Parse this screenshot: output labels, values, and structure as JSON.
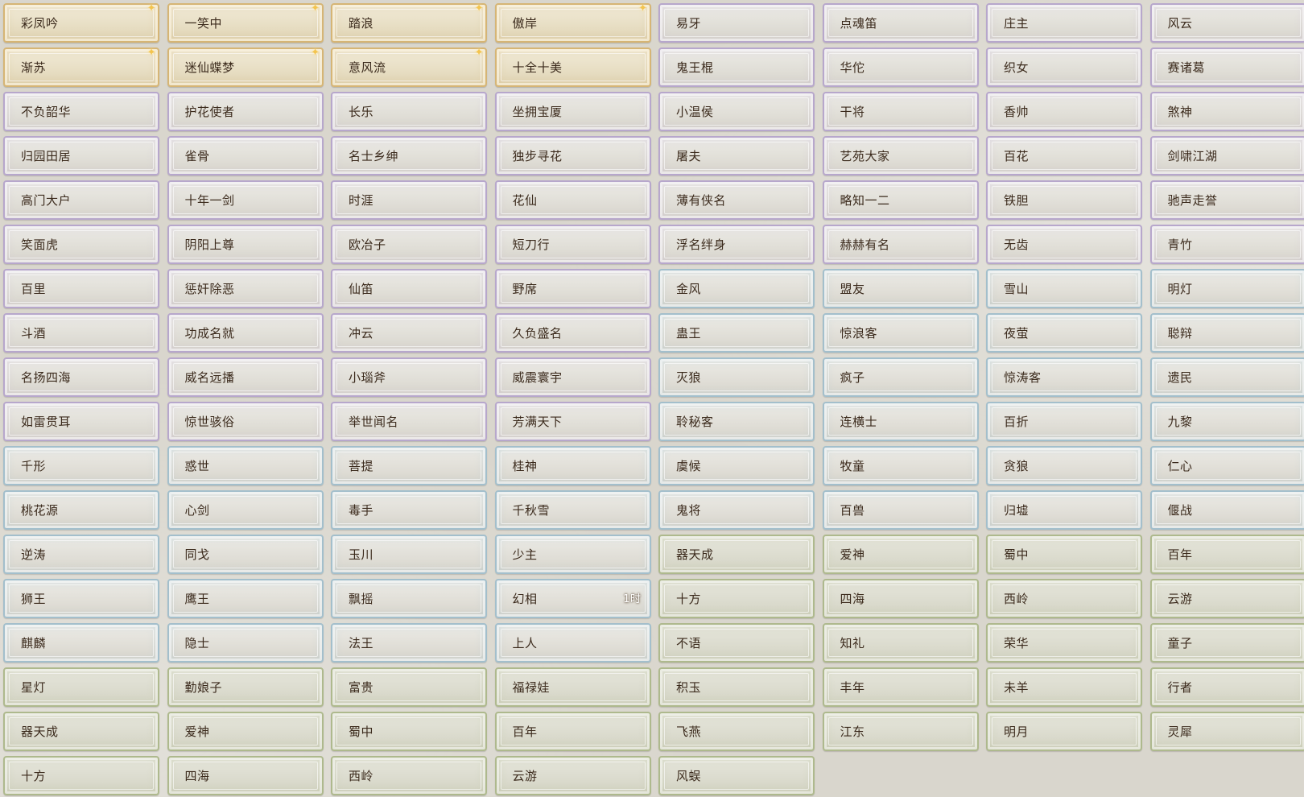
{
  "titles": [
    {
      "label": "彩凤吟",
      "tier": "gold",
      "sparkle": true
    },
    {
      "label": "一笑中",
      "tier": "gold",
      "sparkle": true
    },
    {
      "label": "踏浪",
      "tier": "gold",
      "sparkle": true
    },
    {
      "label": "傲岸",
      "tier": "gold",
      "sparkle": true
    },
    {
      "label": "易牙",
      "tier": "purple"
    },
    {
      "label": "点魂笛",
      "tier": "purple"
    },
    {
      "label": "庄主",
      "tier": "purple"
    },
    {
      "label": "风云",
      "tier": "purple"
    },
    {
      "label": "渐苏",
      "tier": "gold",
      "sparkle": true
    },
    {
      "label": "迷仙蝶梦",
      "tier": "gold",
      "sparkle": true
    },
    {
      "label": "意风流",
      "tier": "gold",
      "sparkle": true
    },
    {
      "label": "十全十美",
      "tier": "gold"
    },
    {
      "label": "鬼王棍",
      "tier": "purple"
    },
    {
      "label": "华佗",
      "tier": "purple"
    },
    {
      "label": "织女",
      "tier": "purple"
    },
    {
      "label": "赛诸葛",
      "tier": "purple"
    },
    {
      "label": "不负韶华",
      "tier": "purple"
    },
    {
      "label": "护花使者",
      "tier": "purple"
    },
    {
      "label": "长乐",
      "tier": "purple"
    },
    {
      "label": "坐拥宝厦",
      "tier": "purple"
    },
    {
      "label": "小温侯",
      "tier": "purple"
    },
    {
      "label": "干将",
      "tier": "purple"
    },
    {
      "label": "香帅",
      "tier": "purple"
    },
    {
      "label": "煞神",
      "tier": "purple"
    },
    {
      "label": "归园田居",
      "tier": "purple"
    },
    {
      "label": "雀骨",
      "tier": "purple"
    },
    {
      "label": "名士乡绅",
      "tier": "purple"
    },
    {
      "label": "独步寻花",
      "tier": "purple"
    },
    {
      "label": "屠夫",
      "tier": "purple"
    },
    {
      "label": "艺苑大家",
      "tier": "purple"
    },
    {
      "label": "百花",
      "tier": "purple"
    },
    {
      "label": "剑啸江湖",
      "tier": "purple"
    },
    {
      "label": "高门大户",
      "tier": "purple"
    },
    {
      "label": "十年一剑",
      "tier": "purple"
    },
    {
      "label": "时涯",
      "tier": "purple"
    },
    {
      "label": "花仙",
      "tier": "purple"
    },
    {
      "label": "薄有侠名",
      "tier": "purple"
    },
    {
      "label": "略知一二",
      "tier": "purple"
    },
    {
      "label": "铁胆",
      "tier": "purple"
    },
    {
      "label": "驰声走誉",
      "tier": "purple"
    },
    {
      "label": "笑面虎",
      "tier": "purple"
    },
    {
      "label": "阴阳上尊",
      "tier": "purple"
    },
    {
      "label": "欧冶子",
      "tier": "purple"
    },
    {
      "label": "短刀行",
      "tier": "purple"
    },
    {
      "label": "浮名绊身",
      "tier": "purple"
    },
    {
      "label": "赫赫有名",
      "tier": "purple"
    },
    {
      "label": "无齿",
      "tier": "purple"
    },
    {
      "label": "青竹",
      "tier": "purple"
    },
    {
      "label": "百里",
      "tier": "purple"
    },
    {
      "label": "惩奸除恶",
      "tier": "purple"
    },
    {
      "label": "仙笛",
      "tier": "purple"
    },
    {
      "label": "野席",
      "tier": "purple"
    },
    {
      "label": "金风",
      "tier": "blue"
    },
    {
      "label": "盟友",
      "tier": "blue"
    },
    {
      "label": "雪山",
      "tier": "blue"
    },
    {
      "label": "明灯",
      "tier": "blue"
    },
    {
      "label": "斗酒",
      "tier": "purple"
    },
    {
      "label": "功成名就",
      "tier": "purple"
    },
    {
      "label": "冲云",
      "tier": "purple"
    },
    {
      "label": "久负盛名",
      "tier": "purple"
    },
    {
      "label": "蛊王",
      "tier": "blue"
    },
    {
      "label": "惊浪客",
      "tier": "blue"
    },
    {
      "label": "夜萤",
      "tier": "blue"
    },
    {
      "label": "聪辩",
      "tier": "blue"
    },
    {
      "label": "名扬四海",
      "tier": "purple"
    },
    {
      "label": "威名远播",
      "tier": "purple"
    },
    {
      "label": "小瑙斧",
      "tier": "purple"
    },
    {
      "label": "威震寰宇",
      "tier": "purple"
    },
    {
      "label": "灭狼",
      "tier": "blue"
    },
    {
      "label": "疯子",
      "tier": "blue"
    },
    {
      "label": "惊涛客",
      "tier": "blue"
    },
    {
      "label": "遗民",
      "tier": "blue"
    },
    {
      "label": "如雷贯耳",
      "tier": "purple"
    },
    {
      "label": "惊世骇俗",
      "tier": "purple"
    },
    {
      "label": "举世闻名",
      "tier": "purple"
    },
    {
      "label": "芳满天下",
      "tier": "purple"
    },
    {
      "label": "聆秘客",
      "tier": "blue"
    },
    {
      "label": "连横士",
      "tier": "blue"
    },
    {
      "label": "百折",
      "tier": "blue"
    },
    {
      "label": "九黎",
      "tier": "blue"
    },
    {
      "label": "千形",
      "tier": "blue"
    },
    {
      "label": "惑世",
      "tier": "blue"
    },
    {
      "label": "菩提",
      "tier": "blue"
    },
    {
      "label": "桂神",
      "tier": "blue"
    },
    {
      "label": "虞候",
      "tier": "blue"
    },
    {
      "label": "牧童",
      "tier": "blue"
    },
    {
      "label": "贪狼",
      "tier": "blue"
    },
    {
      "label": "仁心",
      "tier": "blue"
    },
    {
      "label": "桃花源",
      "tier": "blue"
    },
    {
      "label": "心剑",
      "tier": "blue"
    },
    {
      "label": "毒手",
      "tier": "blue"
    },
    {
      "label": "千秋雪",
      "tier": "blue"
    },
    {
      "label": "鬼将",
      "tier": "blue"
    },
    {
      "label": "百兽",
      "tier": "blue"
    },
    {
      "label": "归墟",
      "tier": "blue"
    },
    {
      "label": "偃战",
      "tier": "blue"
    },
    {
      "label": "逆涛",
      "tier": "blue"
    },
    {
      "label": "同戈",
      "tier": "blue"
    },
    {
      "label": "玉川",
      "tier": "blue"
    },
    {
      "label": "少主",
      "tier": "blue"
    },
    {
      "label": "器天成",
      "tier": "green"
    },
    {
      "label": "爱神",
      "tier": "green"
    },
    {
      "label": "蜀中",
      "tier": "green"
    },
    {
      "label": "百年",
      "tier": "green"
    },
    {
      "label": "狮王",
      "tier": "blue"
    },
    {
      "label": "鹰王",
      "tier": "blue"
    },
    {
      "label": "飘摇",
      "tier": "blue"
    },
    {
      "label": "幻相",
      "tier": "blue",
      "badge": "1时"
    },
    {
      "label": "十方",
      "tier": "green"
    },
    {
      "label": "四海",
      "tier": "green"
    },
    {
      "label": "西岭",
      "tier": "green"
    },
    {
      "label": "云游",
      "tier": "green"
    },
    {
      "label": "麒麟",
      "tier": "blue"
    },
    {
      "label": "隐士",
      "tier": "blue"
    },
    {
      "label": "法王",
      "tier": "blue"
    },
    {
      "label": "上人",
      "tier": "blue"
    },
    {
      "label": "不语",
      "tier": "green"
    },
    {
      "label": "知礼",
      "tier": "green"
    },
    {
      "label": "荣华",
      "tier": "green"
    },
    {
      "label": "童子",
      "tier": "green"
    },
    {
      "label": "星灯",
      "tier": "green"
    },
    {
      "label": "勤娘子",
      "tier": "green"
    },
    {
      "label": "富贵",
      "tier": "green"
    },
    {
      "label": "福禄娃",
      "tier": "green"
    },
    {
      "label": "积玉",
      "tier": "green"
    },
    {
      "label": "丰年",
      "tier": "green"
    },
    {
      "label": "未羊",
      "tier": "green"
    },
    {
      "label": "行者",
      "tier": "green"
    },
    {
      "label": "器天成",
      "tier": "green"
    },
    {
      "label": "爱神",
      "tier": "green"
    },
    {
      "label": "蜀中",
      "tier": "green"
    },
    {
      "label": "百年",
      "tier": "green"
    },
    {
      "label": "飞燕",
      "tier": "green"
    },
    {
      "label": "江东",
      "tier": "green"
    },
    {
      "label": "明月",
      "tier": "green"
    },
    {
      "label": "灵犀",
      "tier": "green"
    },
    {
      "label": "十方",
      "tier": "green"
    },
    {
      "label": "四海",
      "tier": "green"
    },
    {
      "label": "西岭",
      "tier": "green"
    },
    {
      "label": "云游",
      "tier": "green"
    },
    {
      "label": "风蜈",
      "tier": "green"
    }
  ],
  "icons": {
    "sparkle": "✦"
  }
}
